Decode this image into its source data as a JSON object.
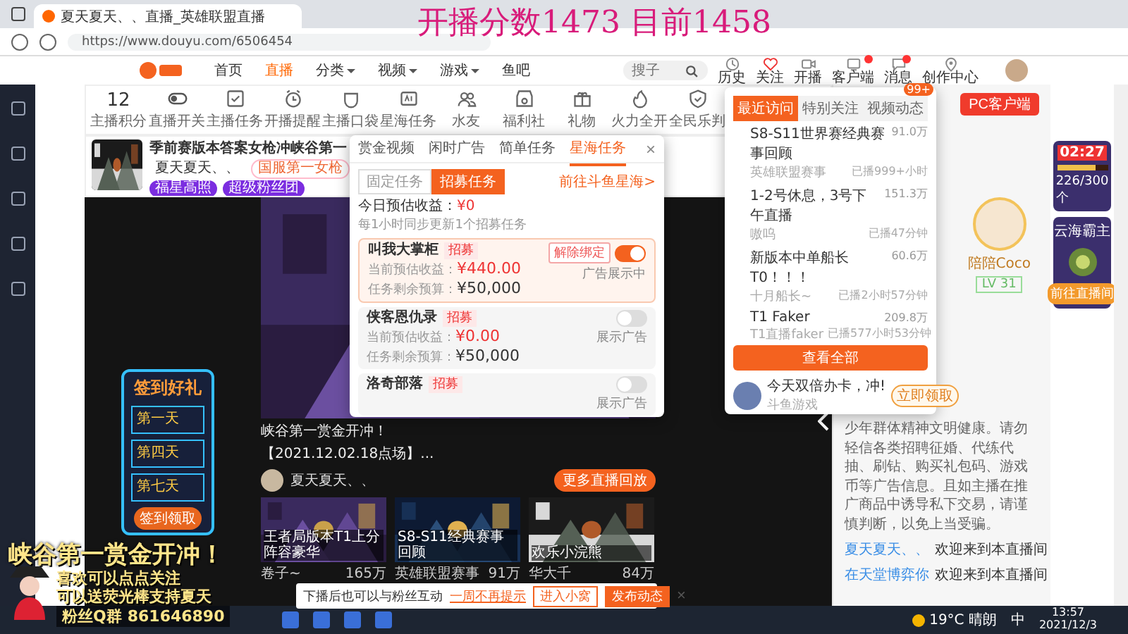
{
  "browser": {
    "tab_title": "夏天夏天、、直播_英雄联盟直播",
    "url": "https://www.douyu.com/6506454"
  },
  "score_overlay": "开播分数1473 目前1458",
  "nav": {
    "items": [
      {
        "label": "首页",
        "selected": false,
        "dropdown": false
      },
      {
        "label": "直播",
        "selected": true,
        "dropdown": false
      },
      {
        "label": "分类",
        "selected": false,
        "dropdown": true
      },
      {
        "label": "视频",
        "selected": false,
        "dropdown": true
      },
      {
        "label": "游戏",
        "selected": false,
        "dropdown": true
      },
      {
        "label": "鱼吧",
        "selected": false,
        "dropdown": false
      }
    ],
    "search": {
      "placeholder": "搜子"
    },
    "icons": [
      {
        "kind": "history",
        "label": "历史",
        "badge": false
      },
      {
        "kind": "heart",
        "label": "关注",
        "badge": false
      },
      {
        "kind": "camera",
        "label": "开播",
        "badge": false
      },
      {
        "kind": "client",
        "label": "客户端",
        "badge": true
      },
      {
        "kind": "message",
        "label": "消息",
        "badge": true
      },
      {
        "kind": "pin",
        "label": "创作中心",
        "badge": false
      }
    ]
  },
  "toolbar": {
    "score": "12",
    "score_label": "主播积分",
    "items": [
      {
        "kind": "toggle",
        "label": "直播开关"
      },
      {
        "kind": "checklist",
        "label": "主播任务"
      },
      {
        "kind": "clock",
        "label": "开播提醒"
      },
      {
        "kind": "pocket",
        "label": "主播口袋"
      },
      {
        "kind": "ad",
        "label": "星海任务"
      },
      {
        "kind": "people",
        "label": "水友"
      },
      {
        "kind": "shop",
        "label": "福利社"
      },
      {
        "kind": "gift",
        "label": "礼物"
      },
      {
        "kind": "fire",
        "label": "火力全开"
      },
      {
        "kind": "shield",
        "label": "全民乐判"
      }
    ]
  },
  "header": {
    "title": "季前赛版本答案女枪冲峡谷第一",
    "streamer": "夏天夏天、、",
    "rank_tag": "国服第一女枪",
    "badges": [
      "福星高照",
      "超级粉丝团"
    ]
  },
  "video": {
    "caption": "峡谷第一赏金开冲！",
    "replay": "【2021.12.02.18点场】...",
    "streamer": "夏天夏天、、",
    "more_button": "更多直播回放",
    "thumbs": [
      {
        "caption": "王者局版本T1上分阵容豪华",
        "author": "卷子~",
        "heat": "165万"
      },
      {
        "caption": "S8-S11经典赛事回顾",
        "author": "英雄联盟赛事",
        "heat": "91万"
      },
      {
        "caption": "欢乐小浣熊",
        "author": "华大千",
        "heat": "84万"
      }
    ]
  },
  "notice": {
    "text": "下播后也可以与粉丝互动",
    "link": "一周不再提示",
    "buttons": [
      "进入小窝",
      "发布动态"
    ],
    "close": "×"
  },
  "task_popup": {
    "tabs": [
      {
        "label": "赏金视频",
        "selected": false
      },
      {
        "label": "闲时广告",
        "selected": false
      },
      {
        "label": "简单任务",
        "selected": false
      },
      {
        "label": "星海任务",
        "selected": true
      }
    ],
    "close": "×",
    "segments": [
      {
        "label": "固定任务",
        "selected": false
      },
      {
        "label": "招募任务",
        "selected": true
      }
    ],
    "link": "前往斗鱼星海>",
    "earnings_label": "今日预估收益：",
    "earnings": "¥0",
    "note": "每1小时同步更新1个招募任务",
    "tasks": [
      {
        "name": "叫我大掌柜",
        "tag": "招募",
        "income_label": "当前预估收益：",
        "income": "¥440.00",
        "budget_label": "任务剩余预算：",
        "budget": "¥50,000",
        "action": "解除绑定",
        "on": true,
        "status": "广告展示中"
      },
      {
        "name": "侠客恩仇录",
        "tag": "招募",
        "income_label": "当前预估收益：",
        "income": "¥0.00",
        "budget_label": "任务剩余预算：",
        "budget": "¥50,000",
        "on": false,
        "status": "展示广告"
      },
      {
        "name": "洛奇部落",
        "tag": "招募",
        "on": false,
        "status": "展示广告"
      }
    ]
  },
  "recent_popup": {
    "tabs": [
      {
        "label": "最近访问",
        "selected": true
      },
      {
        "label": "特别关注",
        "selected": false
      },
      {
        "label": "视频动态",
        "selected": false,
        "badge": "99+"
      }
    ],
    "items": [
      {
        "title": "S8-S11世界赛经典赛事回顾",
        "subtitle": "英雄联盟赛事",
        "heat": "91.0万",
        "status": "已播999+小时"
      },
      {
        "title": "1-2号休息，3号下午直播",
        "subtitle": "嗷呜",
        "heat": "151.3万",
        "status": "已播47分钟"
      },
      {
        "title": "新版本中单船长T0！！！",
        "subtitle": "十月船长~",
        "heat": "60.6万",
        "status": "已播2小时57分钟"
      },
      {
        "title": "T1 Faker",
        "subtitle": "T1直播faker",
        "heat": "209.8万",
        "status": "已播577小时53分钟"
      }
    ],
    "button": "查看全部",
    "promo": {
      "title": "今天双倍办卡，冲!",
      "subtitle": "斗鱼游戏",
      "button": "立即领取"
    }
  },
  "chat": {
    "pc_button": "PC客户端",
    "anchor": "陪陪Coco",
    "anchor_rank": "LV 31",
    "system": "少年群体精神文明健康。请勿轻信各类招聘征婚、代练代抽、刷钻、购买礼包码、游戏币等广告信息。且如主播在推广商品中诱导私下交易，请谨慎判断，以免上当受骗。",
    "messages": [
      {
        "user": "夏天夏天、、",
        "text": "欢迎来到本直播间"
      },
      {
        "user": "在天堂博弈你",
        "text": "欢迎来到本直播间"
      }
    ]
  },
  "ads": {
    "timer": "02:27",
    "progress_text": "226/300个",
    "level": 0.75,
    "title": "云海霸主",
    "button": "前往直播间"
  },
  "stream_overlay": {
    "checkin_title": "签到好礼",
    "days": [
      "第一天",
      "第四天",
      "第七天"
    ],
    "checkin_button": "签到领取",
    "banner": "峡谷第一赏金开冲！",
    "lines": [
      "喜欢可以点点关注",
      "可以送荧光棒支持夏天"
    ],
    "qq_label": "粉丝Q群",
    "qq_number": "861646890"
  },
  "taskbar": {
    "weather": "19°C 晴朗",
    "ime": "中",
    "time": "13:57",
    "date": "2021/12/3"
  }
}
